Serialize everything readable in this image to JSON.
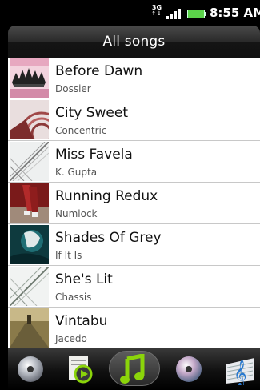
{
  "status_bar": {
    "network": "3G",
    "time": "8:55 AM"
  },
  "header": {
    "title": "All songs"
  },
  "songs": [
    {
      "title": "Before Dawn",
      "artist": "Dossier"
    },
    {
      "title": "City Sweet",
      "artist": "Concentric"
    },
    {
      "title": "Miss Favela",
      "artist": "K. Gupta"
    },
    {
      "title": "Running Redux",
      "artist": "Numlock"
    },
    {
      "title": "Shades Of Grey",
      "artist": "If It Is"
    },
    {
      "title": "She's Lit",
      "artist": "Chassis"
    },
    {
      "title": "Vintabu",
      "artist": "Jacedo"
    }
  ],
  "tab_bar": {
    "tabs": [
      {
        "icon": "cd-icon"
      },
      {
        "icon": "playlist-play-icon"
      },
      {
        "icon": "music-note-icon",
        "active": true
      },
      {
        "icon": "album-disc-icon"
      },
      {
        "icon": "treble-clef-icon"
      }
    ]
  },
  "colors": {
    "accent_green": "#8bd40a",
    "list_background": "#ffffff",
    "header_background": "#222222"
  }
}
